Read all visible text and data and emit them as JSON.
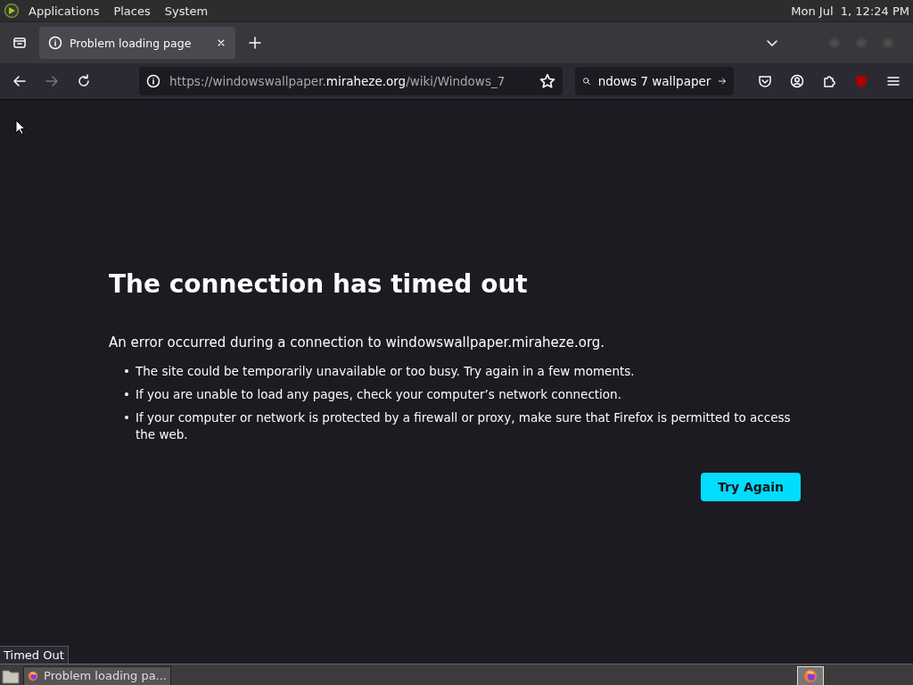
{
  "top_panel": {
    "menus": [
      "Applications",
      "Places",
      "System"
    ],
    "clock": "Mon Jul  1, 12:24 PM"
  },
  "tabs": [
    {
      "title": "Problem loading page",
      "selected": true
    }
  ],
  "toolbar": {
    "url": {
      "prefix": "https://windowswallpaper.",
      "domain": "miraheze.org",
      "path": "/wiki/Windows_7"
    },
    "search_value": "ndows 7 wallpaper"
  },
  "error_page": {
    "title": "The connection has timed out",
    "intro": "An error occurred during a connection to windowswallpaper.miraheze.org.",
    "bullets": [
      {
        "marker": "•",
        "text": "The site could be temporarily unavailable or too busy. Try again in a few moments."
      },
      {
        "marker": "•",
        "text": "If you are unable to load any pages, check your computer’s network connection."
      },
      {
        "marker": "•",
        "text": "If your computer or network is protected by a firewall or proxy, make sure that Firefox is permitted to access the web."
      }
    ],
    "button": "Try Again"
  },
  "status_bar": "Timed Out",
  "taskbar": {
    "windows": [
      {
        "title": "Problem loading pa...",
        "selected": true
      }
    ]
  }
}
